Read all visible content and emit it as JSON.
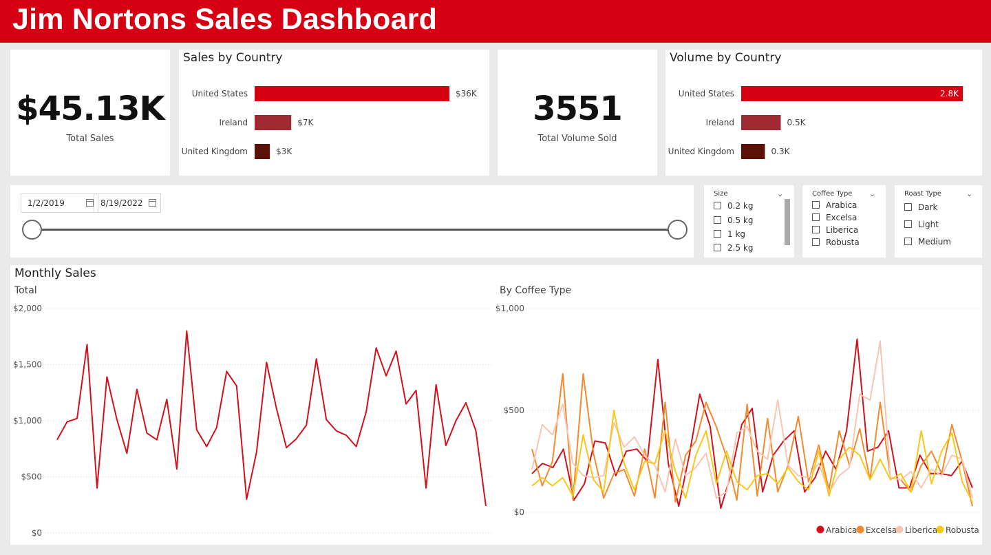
{
  "header": {
    "title": "Jim Nortons Sales Dashboard"
  },
  "kpis": {
    "sales": {
      "value": "$45.13K",
      "label": "Total Sales"
    },
    "volume": {
      "value": "3551",
      "label": "Total Volume Sold"
    }
  },
  "colors": {
    "header": "#d50011",
    "arabica": "#d1111c",
    "excelsa": "#f28a2f",
    "liberica": "#f7c6b3",
    "robusta": "#f6c819",
    "country_us": "#d50011",
    "country_ie": "#9e2a32",
    "country_uk": "#5a1208"
  },
  "filters": {
    "start_date": "1/2/2019",
    "end_date": "8/19/2022",
    "size": {
      "title": "Size",
      "options": [
        "0.2 kg",
        "0.5 kg",
        "1 kg",
        "2.5 kg"
      ]
    },
    "coffee_type": {
      "title": "Coffee Type",
      "options": [
        "Arabica",
        "Excelsa",
        "Liberica",
        "Robusta"
      ]
    },
    "roast_type": {
      "title": "Roast Type",
      "options": [
        "Dark",
        "Light",
        "Medium"
      ]
    }
  },
  "monthly": {
    "title": "Monthly Sales"
  },
  "chart_data": [
    {
      "type": "bar",
      "title": "Sales by Country",
      "orientation": "horizontal",
      "categories": [
        "United States",
        "Ireland",
        "United Kingdom"
      ],
      "values": [
        35640,
        6700,
        2790
      ],
      "data_labels": [
        "$36K",
        "$7K",
        "$3K"
      ],
      "colors": [
        "#d50011",
        "#9e2a32",
        "#5a1208"
      ]
    },
    {
      "type": "bar",
      "title": "Volume by Country",
      "orientation": "horizontal",
      "categories": [
        "United States",
        "Ireland",
        "United Kingdom"
      ],
      "values": [
        2.8,
        0.5,
        0.3
      ],
      "data_labels": [
        "2.8K",
        "0.5K",
        "0.3K"
      ],
      "colors": [
        "#d50011",
        "#9e2a32",
        "#5a1208"
      ]
    },
    {
      "type": "line",
      "title": "Total",
      "ylim": [
        0,
        2000
      ],
      "yticks": [
        0,
        500,
        1000,
        1500,
        2000
      ],
      "ytick_labels": [
        "$0",
        "$500",
        "$1,000",
        "$1,500",
        "$2,000"
      ],
      "grid": true,
      "series": [
        {
          "values": [
            830,
            990,
            1020,
            1680,
            400,
            1390,
            1010,
            710,
            1280,
            890,
            830,
            1190,
            570,
            1800,
            920,
            770,
            940,
            1440,
            1310,
            300,
            720,
            1520,
            1110,
            760,
            840,
            960,
            1550,
            1010,
            910,
            870,
            770,
            1080,
            1650,
            1400,
            1620,
            1150,
            1270,
            400,
            1320,
            780,
            1000,
            1160,
            910,
            240
          ],
          "color": "#d1111c"
        }
      ]
    },
    {
      "type": "line",
      "title": "By Coffee Type",
      "ylim": [
        0,
        1000
      ],
      "yticks": [
        0,
        500,
        1000
      ],
      "ytick_labels": [
        "$0",
        "$500",
        "$1,000"
      ],
      "grid": true,
      "legend": "bottom-right",
      "series": [
        {
          "name": "Arabica",
          "color": "#d1111c",
          "values": [
            190,
            240,
            220,
            310,
            60,
            140,
            350,
            340,
            180,
            300,
            310,
            250,
            750,
            240,
            30,
            280,
            580,
            420,
            20,
            190,
            430,
            510,
            100,
            280,
            350,
            400,
            100,
            170,
            300,
            210,
            400,
            850,
            300,
            320,
            400,
            120,
            120,
            280,
            190,
            190,
            180,
            250,
            120
          ]
        },
        {
          "name": "Excelsa",
          "color": "#f28a2f",
          "values": [
            310,
            130,
            250,
            680,
            60,
            680,
            290,
            70,
            190,
            210,
            80,
            310,
            70,
            540,
            50,
            280,
            350,
            540,
            420,
            270,
            60,
            530,
            80,
            460,
            100,
            230,
            470,
            150,
            330,
            110,
            400,
            230,
            410,
            160,
            540,
            170,
            160,
            100,
            230,
            300,
            190,
            430,
            250,
            30
          ]
        },
        {
          "name": "Liberica",
          "color": "#f7c6b3",
          "values": [
            210,
            430,
            380,
            530,
            240,
            180,
            170,
            180,
            440,
            320,
            370,
            280,
            230,
            100,
            360,
            180,
            220,
            290,
            70,
            100,
            390,
            420,
            300,
            260,
            550,
            230,
            180,
            170,
            240,
            100,
            180,
            220,
            580,
            550,
            840,
            170,
            160,
            200,
            120,
            210,
            180,
            280,
            260,
            70
          ]
        },
        {
          "name": "Robusta",
          "color": "#f6c819",
          "values": [
            130,
            170,
            130,
            170,
            80,
            380,
            160,
            100,
            500,
            240,
            110,
            250,
            240,
            400,
            200,
            70,
            280,
            400,
            140,
            300,
            150,
            110,
            180,
            190,
            140,
            220,
            150,
            110,
            300,
            80,
            260,
            320,
            280,
            160,
            260,
            160,
            190,
            100,
            400,
            140,
            300,
            390,
            150,
            50
          ]
        }
      ]
    }
  ]
}
